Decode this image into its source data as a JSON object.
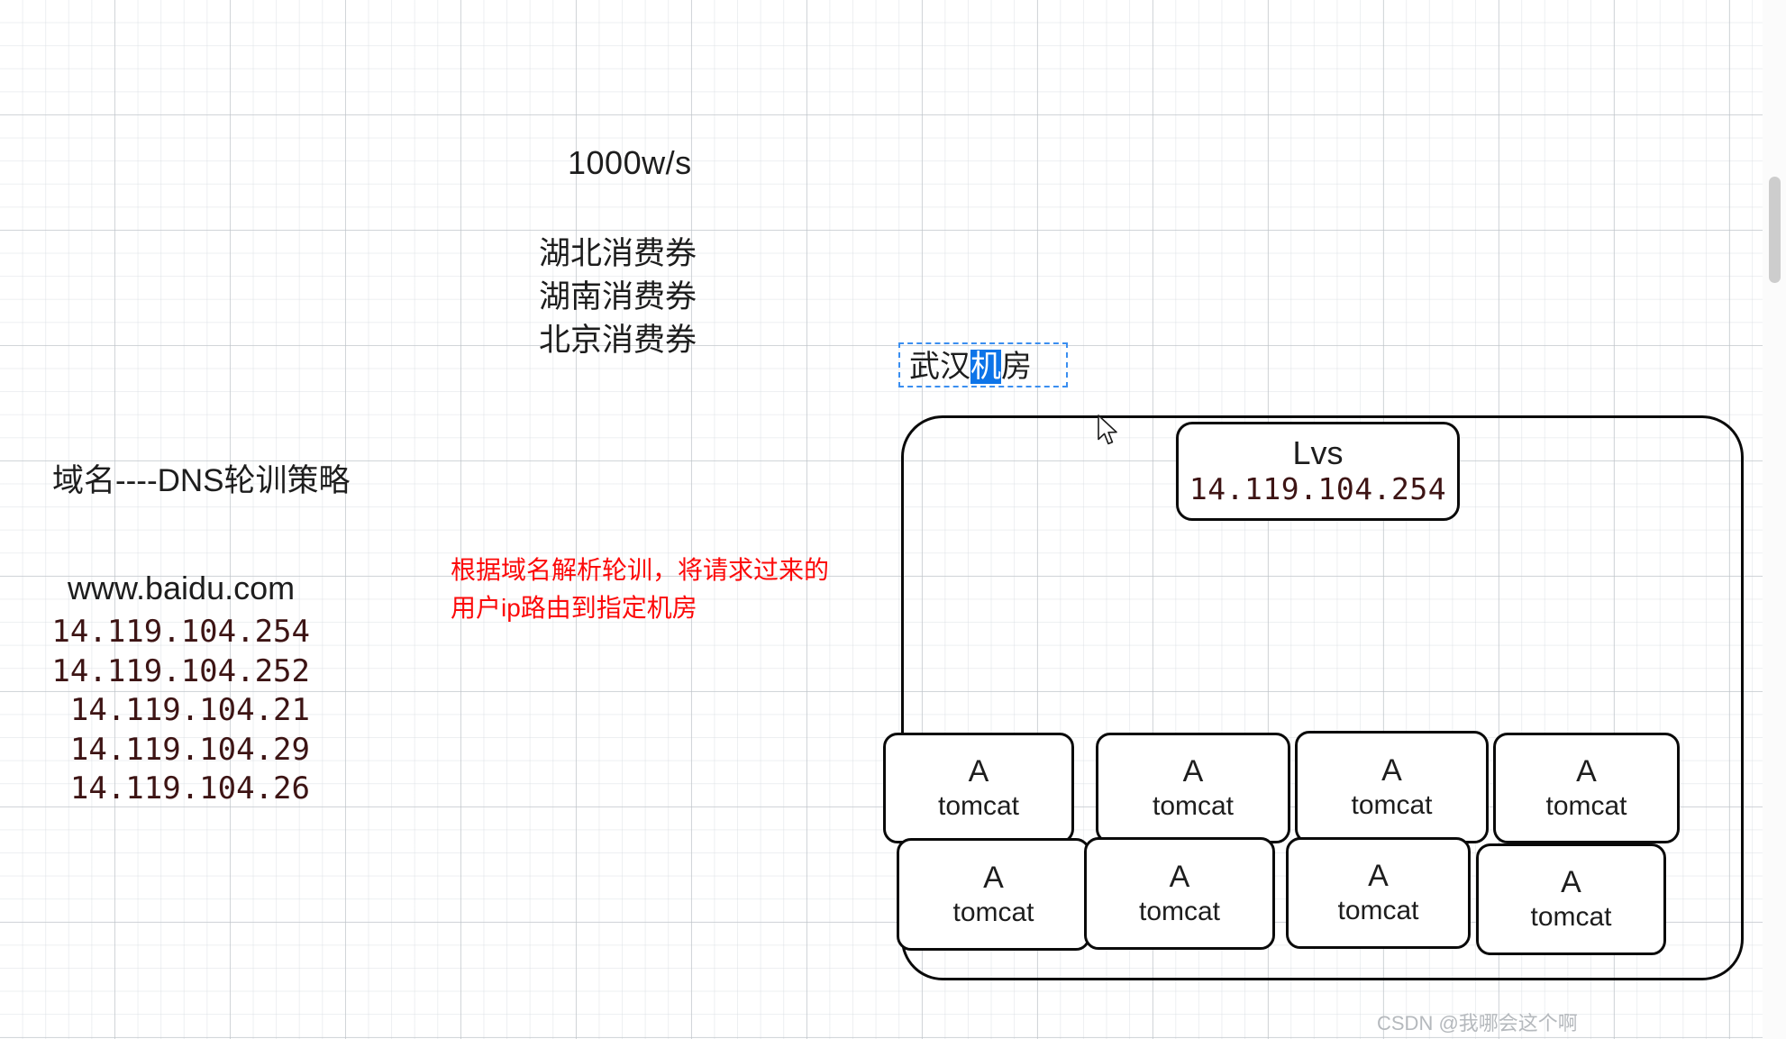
{
  "annotations": {
    "rate_label": "1000w/s",
    "coupon_lines": [
      "湖北消费券",
      "湖南消费券",
      "北京消费券"
    ],
    "dns_strategy": "域名----DNS轮训策略",
    "domain": "www.baidu.com",
    "dns_ips": [
      "14.119.104.254",
      "14.119.104.252",
      "14.119.104.21",
      "14.119.104.29",
      "14.119.104.26"
    ],
    "red_note_lines": [
      "根据域名解析轮训，将请求过来的",
      "用户ip路由到指定机房"
    ]
  },
  "room_label": {
    "prefix": "武汉",
    "selected": "机",
    "suffix": "房",
    "selection_color": "#0d74e8",
    "outline_color": "#3a8ef0"
  },
  "diagram": {
    "lvs": {
      "name": "Lvs",
      "ip": "14.119.104.254"
    },
    "nodes": [
      {
        "line1": "A",
        "line2": "tomcat"
      },
      {
        "line1": "A",
        "line2": "tomcat"
      },
      {
        "line1": "A",
        "line2": "tomcat"
      },
      {
        "line1": "A",
        "line2": "tomcat"
      },
      {
        "line1": "A",
        "line2": "tomcat"
      },
      {
        "line1": "A",
        "line2": "tomcat"
      },
      {
        "line1": "A",
        "line2": "tomcat"
      },
      {
        "line1": "A",
        "line2": "tomcat"
      }
    ]
  },
  "watermark": "CSDN @我哪会这个啊"
}
